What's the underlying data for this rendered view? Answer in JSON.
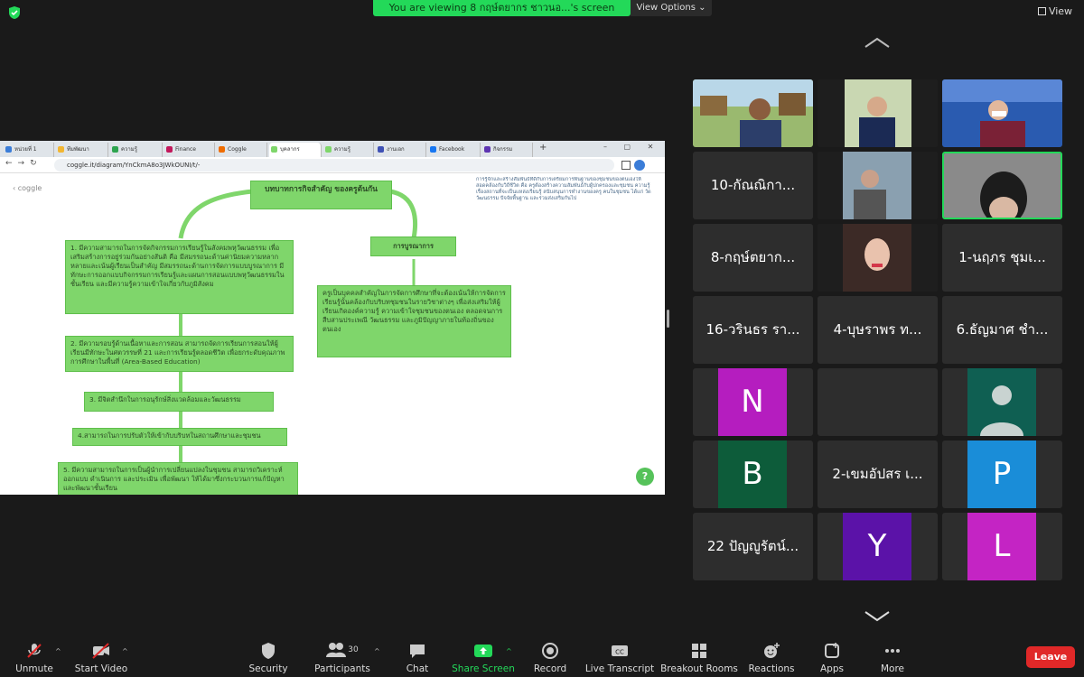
{
  "banner": {
    "viewing_text": "You are viewing 8 กฤษ์ตยากร ชาวนอ...'s screen",
    "view_options_label": "View Options ⌄",
    "view_label": "View"
  },
  "browser": {
    "tabs": [
      {
        "label": "หน่วยที่ 1"
      },
      {
        "label": "ทีมพัฒนา"
      },
      {
        "label": "ความรู้"
      },
      {
        "label": "Finance"
      },
      {
        "label": "Coggle"
      },
      {
        "label": "บุคลากร"
      },
      {
        "label": "ความรู้"
      },
      {
        "label": "งานเอก"
      },
      {
        "label": "Facebook"
      },
      {
        "label": "กิจกรรม"
      }
    ],
    "url": "coggle.it/diagram/YnCkmA8o3JWkOUNI/t/-",
    "back_label": "‹ coggle"
  },
  "mindmap": {
    "center": "บทบาทการกิจสำคัญ ของครูต้นกัน",
    "sub_node": "การบูรณาการ",
    "nodes": [
      "1. มีความสามารถในการจัดกิจกรรมการเรียนรู้ในสังคมพหุวัฒนธรรม เพื่อเสริมสร้างการอยู่ร่วมกันอย่างสันติ คือ มีสมรรถนะด้านค่านิยมความหลากหลายและเน้นผู้เรียนเป็นสำคัญ มีสมรรถนะด้านการจัดการแบบบูรณาการ มีทักษะการออกแบบกิจกรรมการเรียนรู้และแผนการสอนแบบพหุวัฒนธรรมในชั้นเรียน และมีความรู้ความเข้าใจเกี่ยวกับภูมิสังคม",
      "2. มีความรอบรู้ด้านเนื้อหาและการสอน สามารถจัดการเรียนการสอนให้ผู้เรียนมีทักษะในศตวรรษที่ 21 และการเรียนรู้ตลอดชีวิต เพื่อยกระดับคุณภาพการศึกษาในพื้นที่ (Area-Based Education)",
      "3. มีจิตสำนึกในการอนุรักษ์สิ่งแวดล้อมและวัฒนธรรม",
      "4.สามารถในการปรับตัวให้เข้ากับบริบทในสถานศึกษาและชุมชน",
      "5. มีความสามารถในการเป็นผู้นำการเปลี่ยนแปลงในชุมชน สามารถวิเคราะห์ ออกแบบ ดำเนินการ และประเมิน เพื่อพัฒนา ให้ได้มาซึ่งกระบวนการแก้ปัญหาและพัฒนาชั้นเรียน"
    ],
    "right_node": "ครูเป็นบุคคลสำคัญในการจัดการศึกษาที่จะต้องเน้นให้การจัดการเรียนรู้นั้นคล้องกับบริบทชุมชนในรายวิชาต่างๆ เพื่อส่งเสริมให้ผู้เรียนเกิดองค์ความรู้ ความเข้าใจชุมชนของตนเอง ตลอดจนการสืบสานประเพณี วัฒนธรรม และภูมิปัญญาภายในท้องถิ่นของตนเอง",
    "top_right_text": "การรู้จักและสร้างสัมพันธ์ที่ดีกับการเตรียมการพื้นฐานของชุมชนของตนเองให้สอดคล้องกับวิถีชีวิต คือ ครูต้องสร้างความสัมพันธ์กับผู้ปกครองและชุมชน ความรู้เรื่องสถานที่จะเป็นแหล่งเรียนรู้ สนับสนุนการทำงานของครู คนในชุมชน ได้แก่ วัด วัฒนธรรม ปัจจัยพื้นฐาน และร่วมส่งเสริมกันไป",
    "help": "?"
  },
  "gallery": {
    "tiles": [
      {
        "type": "video",
        "name": ""
      },
      {
        "type": "video",
        "name": ""
      },
      {
        "type": "video",
        "name": ""
      },
      {
        "type": "name",
        "name": "10-กัณณิกา..."
      },
      {
        "type": "video",
        "name": ""
      },
      {
        "type": "video",
        "name": ""
      },
      {
        "type": "name",
        "name": "8-กฤษ์ตยาก..."
      },
      {
        "type": "video",
        "name": ""
      },
      {
        "type": "name",
        "name": "1-นฤภร ชุมเ..."
      },
      {
        "type": "name",
        "name": "16-วรินธร รา..."
      },
      {
        "type": "name",
        "name": "4-บุษราพร ท..."
      },
      {
        "type": "name",
        "name": "6.ธัญมาศ ชำ..."
      },
      {
        "type": "letter",
        "name": "N",
        "color": "#b51dbf"
      },
      {
        "type": "empty",
        "name": ""
      },
      {
        "type": "person",
        "name": ""
      },
      {
        "type": "letter",
        "name": "B",
        "color": "#0d5c3a"
      },
      {
        "type": "name",
        "name": "2-เขมอัปสร เ..."
      },
      {
        "type": "letter",
        "name": "P",
        "color": "#1a8dd8"
      },
      {
        "type": "name",
        "name": "22 ปัญญูรัตน์..."
      },
      {
        "type": "letter",
        "name": "Y",
        "color": "#5b12a8"
      },
      {
        "type": "letter",
        "name": "L",
        "color": "#c424c4"
      }
    ]
  },
  "toolbar": {
    "unmute": "Unmute",
    "start_video": "Start Video",
    "security": "Security",
    "participants": "Participants",
    "participants_count": "30",
    "chat": "Chat",
    "share_screen": "Share Screen",
    "record": "Record",
    "live_transcript": "Live Transcript",
    "breakout_rooms": "Breakout Rooms",
    "reactions": "Reactions",
    "apps": "Apps",
    "more": "More",
    "leave": "Leave"
  },
  "colors": {
    "banner_green": "#23d959",
    "node_green": "#7fd66b",
    "leave_red": "#e02828",
    "share_green": "#23d959"
  }
}
